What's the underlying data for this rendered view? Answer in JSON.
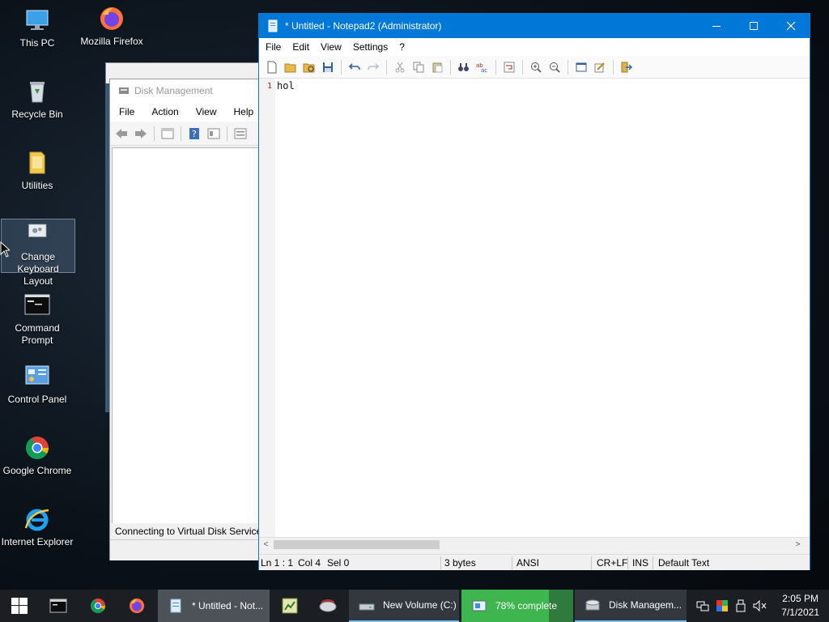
{
  "desktop": {
    "icons": [
      {
        "label": "This PC"
      },
      {
        "label": "Mozilla Firefox"
      },
      {
        "label": "Recycle Bin"
      },
      {
        "label": "Utilities"
      },
      {
        "label": "Change Keyboard Layout"
      },
      {
        "label": "Command Prompt"
      },
      {
        "label": "Control Panel"
      },
      {
        "label": "Google Chrome"
      },
      {
        "label": "Internet Explorer"
      }
    ]
  },
  "disk_management": {
    "title": "Disk Management",
    "menu": [
      "File",
      "Action",
      "View",
      "Help"
    ],
    "status": "Connecting to Virtual Disk Service..."
  },
  "notepad": {
    "title": "* Untitled - Notepad2 (Administrator)",
    "menu": [
      "File",
      "Edit",
      "View",
      "Settings",
      "?"
    ],
    "line_number": "1",
    "content": "hol",
    "status": {
      "position": "Ln 1 : 1",
      "col": "Col 4",
      "sel": "Sel 0",
      "size": "3 bytes",
      "encoding": "ANSI",
      "eol": "CR+LF",
      "mode": "INS",
      "scheme": "Default Text"
    },
    "scroll_left": "<",
    "scroll_right": ">"
  },
  "taskbar": {
    "buttons": [
      {
        "label": "* Untitled - Not..."
      },
      {
        "label": "New Volume (C:)"
      },
      {
        "label": "78% complete",
        "progress": 0.78
      },
      {
        "label": "Disk Managem..."
      }
    ],
    "clock": {
      "time": "2:05 PM",
      "date": "7/1/2021"
    }
  },
  "colors": {
    "titlebar": "#0078d7",
    "taskbar": "#1b1e22",
    "progress": "#3fb54f"
  }
}
